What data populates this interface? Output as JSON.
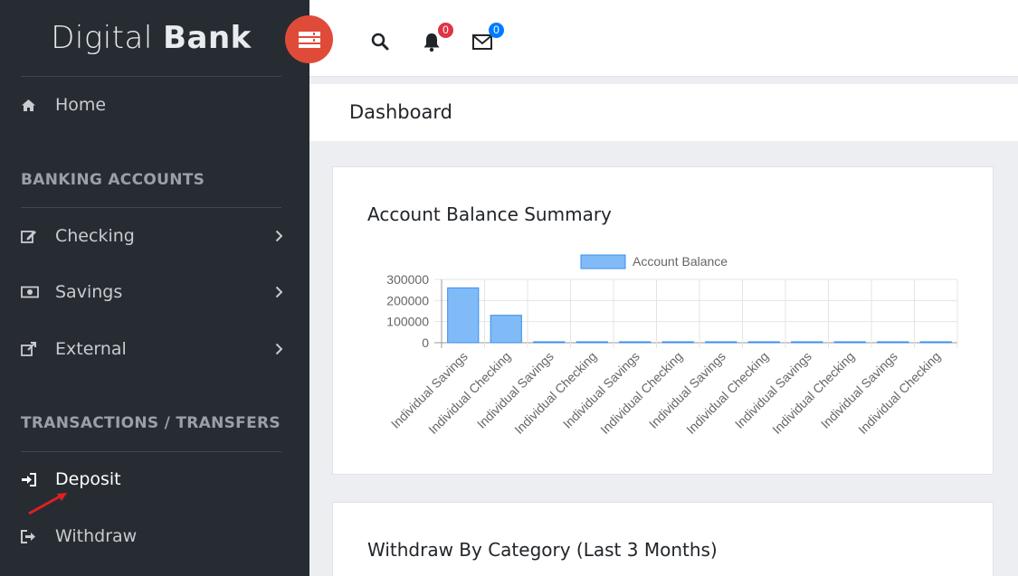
{
  "brand": {
    "light": "Digital",
    "bold": "Bank"
  },
  "sidebar": {
    "home": {
      "label": "Home",
      "icon": "home-icon"
    },
    "sections": [
      {
        "title": "BANKING ACCOUNTS"
      },
      {
        "title": "TRANSACTIONS / TRANSFERS"
      }
    ],
    "accounts": [
      {
        "label": "Checking",
        "icon": "edit-icon"
      },
      {
        "label": "Savings",
        "icon": "money-icon"
      },
      {
        "label": "External",
        "icon": "external-link-icon"
      }
    ],
    "transactions": [
      {
        "label": "Deposit",
        "icon": "sign-in-icon"
      },
      {
        "label": "Withdraw",
        "icon": "sign-out-icon"
      }
    ]
  },
  "header": {
    "notifications_count": "0",
    "messages_count": "0"
  },
  "page": {
    "title": "Dashboard"
  },
  "cards": [
    {
      "title": "Account Balance Summary"
    },
    {
      "title": "Withdraw By Category (Last 3 Months)"
    }
  ],
  "colors": {
    "sidebar_bg": "#272c33",
    "accent_red": "#e04b39",
    "bar_fill": "#80bbf8",
    "bar_border": "#3b8ded",
    "badge_red": "#dc3545",
    "badge_blue": "#007bff"
  },
  "chart_data": {
    "type": "bar",
    "title": "",
    "legend": "Account Balance",
    "legend_position": "top-center",
    "categories": [
      "Individual Savings",
      "Individual Checking",
      "Individual Savings",
      "Individual Checking",
      "Individual Savings",
      "Individual Checking",
      "Individual Savings",
      "Individual Checking",
      "Individual Savings",
      "Individual Checking",
      "Individual Savings",
      "Individual Checking"
    ],
    "series": [
      {
        "name": "Account Balance",
        "values": [
          260000,
          130000,
          0,
          0,
          0,
          0,
          0,
          0,
          0,
          0,
          0,
          0
        ]
      }
    ],
    "yticks": [
      "300000",
      "200000",
      "100000",
      "0"
    ],
    "ylim": [
      0,
      300000
    ],
    "grid": true
  }
}
